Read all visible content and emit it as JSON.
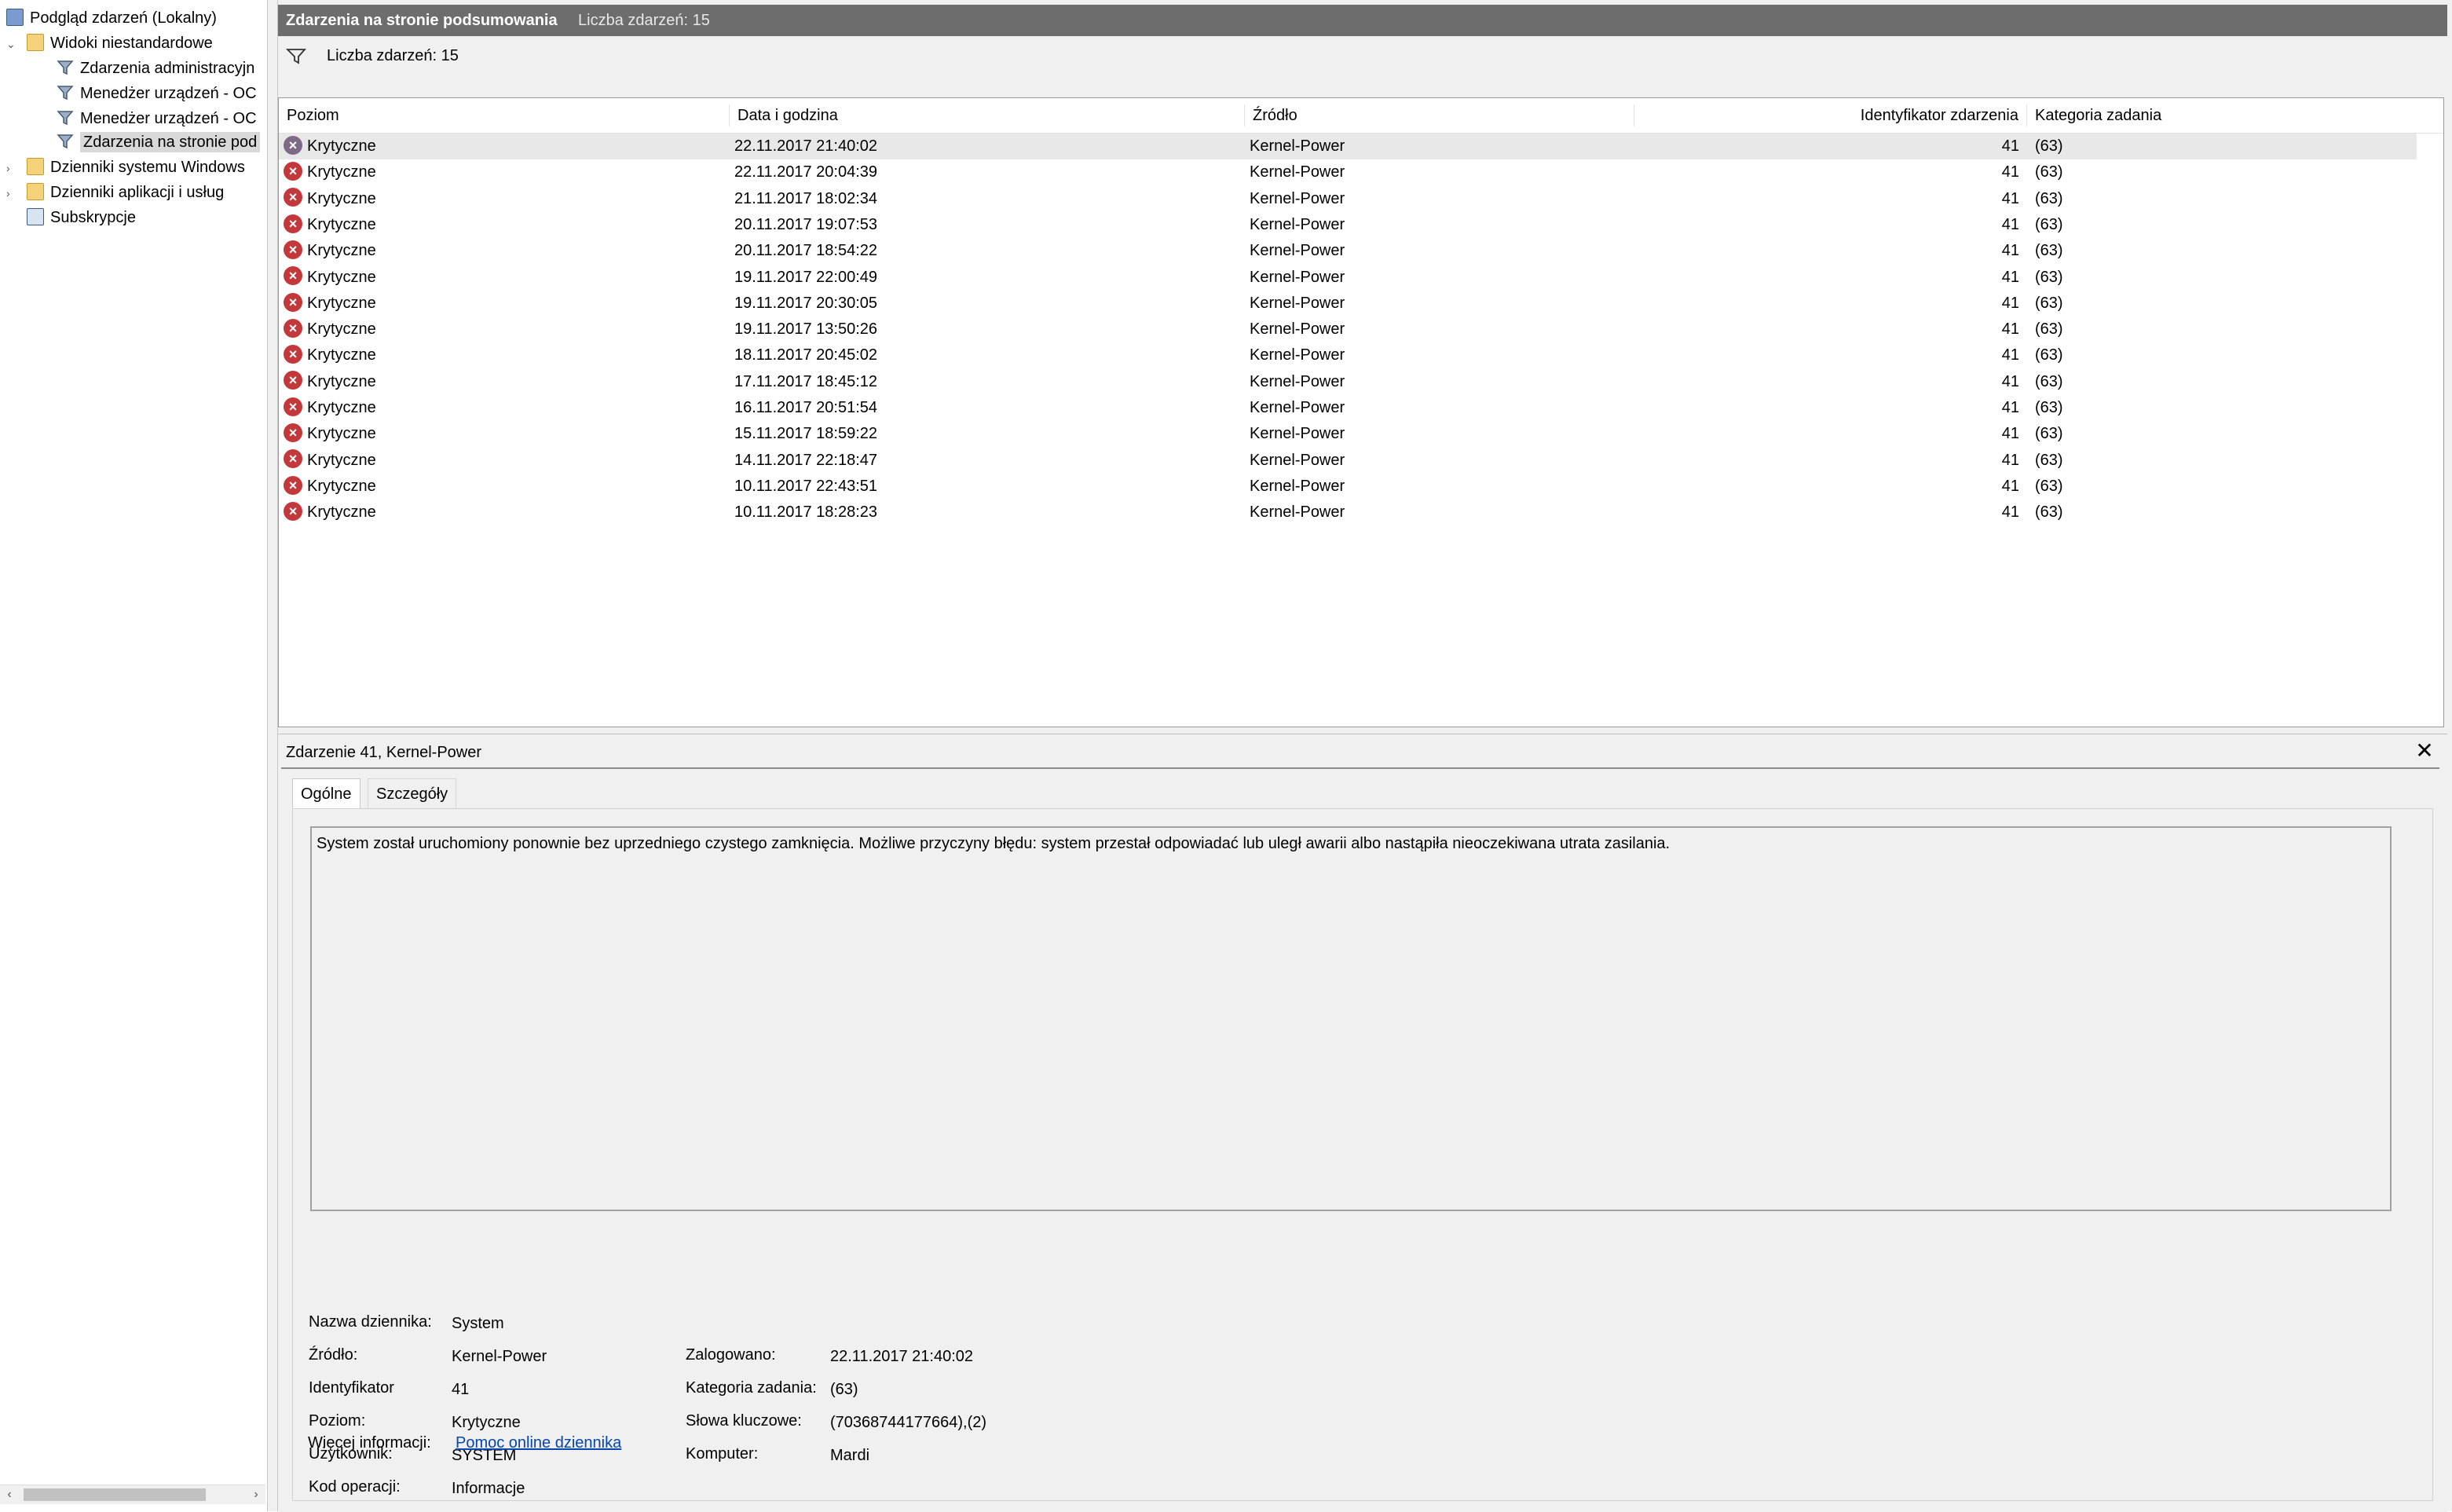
{
  "tree": {
    "root": "Podgląd zdarzeń (Lokalny)",
    "custom_views": "Widoki niestandardowe",
    "views": [
      "Zdarzenia administracyjn",
      "Menedżer urządzeń - OC",
      "Menedżer urządzeń - OC",
      "Zdarzenia na stronie pod"
    ],
    "windows_logs": "Dzienniki systemu Windows",
    "app_logs": "Dzienniki aplikacji i usług",
    "subscriptions": "Subskrypcje"
  },
  "header": {
    "title": "Zdarzenia na stronie podsumowania",
    "count": "Liczba zdarzeń: 15"
  },
  "filter": {
    "count": "Liczba zdarzeń: 15"
  },
  "grid": {
    "columns": [
      "Poziom",
      "Data i godzina",
      "Źródło",
      "Identyfikator zdarzenia",
      "Kategoria zadania"
    ],
    "rows": [
      {
        "level": "Krytyczne",
        "date": "22.11.2017 21:40:02",
        "source": "Kernel-Power",
        "id": "41",
        "category": "(63)"
      },
      {
        "level": "Krytyczne",
        "date": "22.11.2017 20:04:39",
        "source": "Kernel-Power",
        "id": "41",
        "category": "(63)"
      },
      {
        "level": "Krytyczne",
        "date": "21.11.2017 18:02:34",
        "source": "Kernel-Power",
        "id": "41",
        "category": "(63)"
      },
      {
        "level": "Krytyczne",
        "date": "20.11.2017 19:07:53",
        "source": "Kernel-Power",
        "id": "41",
        "category": "(63)"
      },
      {
        "level": "Krytyczne",
        "date": "20.11.2017 18:54:22",
        "source": "Kernel-Power",
        "id": "41",
        "category": "(63)"
      },
      {
        "level": "Krytyczne",
        "date": "19.11.2017 22:00:49",
        "source": "Kernel-Power",
        "id": "41",
        "category": "(63)"
      },
      {
        "level": "Krytyczne",
        "date": "19.11.2017 20:30:05",
        "source": "Kernel-Power",
        "id": "41",
        "category": "(63)"
      },
      {
        "level": "Krytyczne",
        "date": "19.11.2017 13:50:26",
        "source": "Kernel-Power",
        "id": "41",
        "category": "(63)"
      },
      {
        "level": "Krytyczne",
        "date": "18.11.2017 20:45:02",
        "source": "Kernel-Power",
        "id": "41",
        "category": "(63)"
      },
      {
        "level": "Krytyczne",
        "date": "17.11.2017 18:45:12",
        "source": "Kernel-Power",
        "id": "41",
        "category": "(63)"
      },
      {
        "level": "Krytyczne",
        "date": "16.11.2017 20:51:54",
        "source": "Kernel-Power",
        "id": "41",
        "category": "(63)"
      },
      {
        "level": "Krytyczne",
        "date": "15.11.2017 18:59:22",
        "source": "Kernel-Power",
        "id": "41",
        "category": "(63)"
      },
      {
        "level": "Krytyczne",
        "date": "14.11.2017 22:18:47",
        "source": "Kernel-Power",
        "id": "41",
        "category": "(63)"
      },
      {
        "level": "Krytyczne",
        "date": "10.11.2017 22:43:51",
        "source": "Kernel-Power",
        "id": "41",
        "category": "(63)"
      },
      {
        "level": "Krytyczne",
        "date": "10.11.2017 18:28:23",
        "source": "Kernel-Power",
        "id": "41",
        "category": "(63)"
      }
    ]
  },
  "detail": {
    "title": "Zdarzenie 41, Kernel-Power",
    "close": "✕",
    "tabs": [
      "Ogólne",
      "Szczegóły"
    ],
    "description": "System został uruchomiony ponownie bez uprzedniego czystego zamknięcia. Możliwe przyczyny błędu: system przestał odpowiadać lub uległ awarii albo nastąpiła nieoczekiwana utrata zasilania.",
    "fields": {
      "log_name_label": "Nazwa dziennika:",
      "log_name": "System",
      "source_label": "Źródło:",
      "source": "Kernel-Power",
      "logged_label": "Zalogowano:",
      "logged": "22.11.2017 21:40:02",
      "id_label": "Identyfikator",
      "id": "41",
      "task_label": "Kategoria zadania:",
      "task": "(63)",
      "level_label": "Poziom:",
      "level": "Krytyczne",
      "keywords_label": "Słowa kluczowe:",
      "keywords": "(70368744177664),(2)",
      "user_label": "Użytkownik:",
      "user": "SYSTEM",
      "computer_label": "Komputer:",
      "computer": "Mardi",
      "opcode_label": "Kod operacji:",
      "opcode": "Informacje",
      "more_label": "Więcej informacji:",
      "more_link": "Pomoc online dziennika"
    }
  },
  "icons": {
    "error": "error-icon",
    "filter": "filter-icon",
    "folder": "folder-icon",
    "log": "event-viewer-icon",
    "subscriptions": "subscriptions-icon"
  },
  "colors": {
    "title_bar": "#6d6d6d",
    "error": "#c3383a",
    "link": "#0645ad",
    "selection": "#e8e8e8"
  }
}
